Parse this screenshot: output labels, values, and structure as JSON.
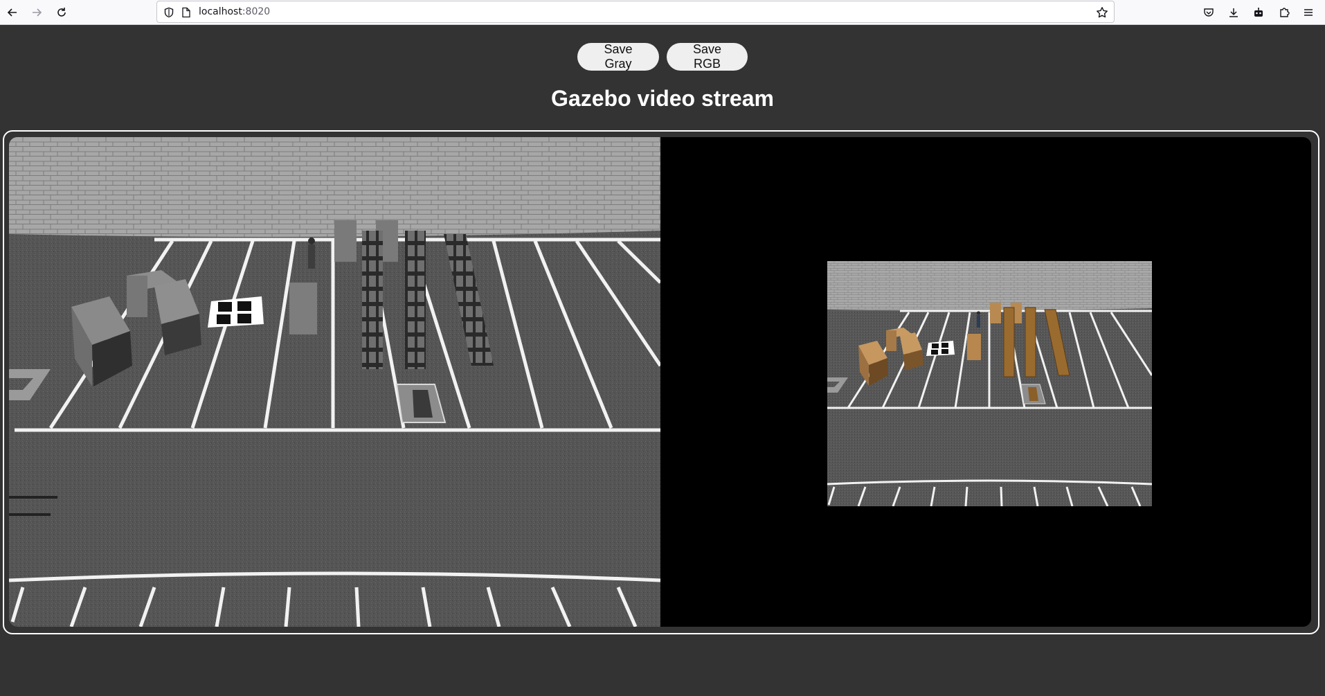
{
  "browser": {
    "url_host": "localhost",
    "url_port": ":8020"
  },
  "toolbar": {
    "save_gray_label": "Save Gray",
    "save_rgb_label": "Save RGB"
  },
  "page": {
    "title": "Gazebo video stream"
  },
  "icons": {
    "back": "back-arrow-icon",
    "forward": "forward-arrow-icon",
    "reload": "reload-icon",
    "shield": "tracking-shield-icon",
    "page": "page-icon",
    "bookmark": "bookmark-star-icon",
    "pocket": "pocket-icon",
    "downloads": "download-icon",
    "extension": "robot-extension-icon",
    "extensions": "puzzle-icon",
    "menu": "hamburger-menu-icon"
  },
  "colors": {
    "page_background": "#333333",
    "frame_border": "#ffffff",
    "viewer_background": "#000000"
  }
}
